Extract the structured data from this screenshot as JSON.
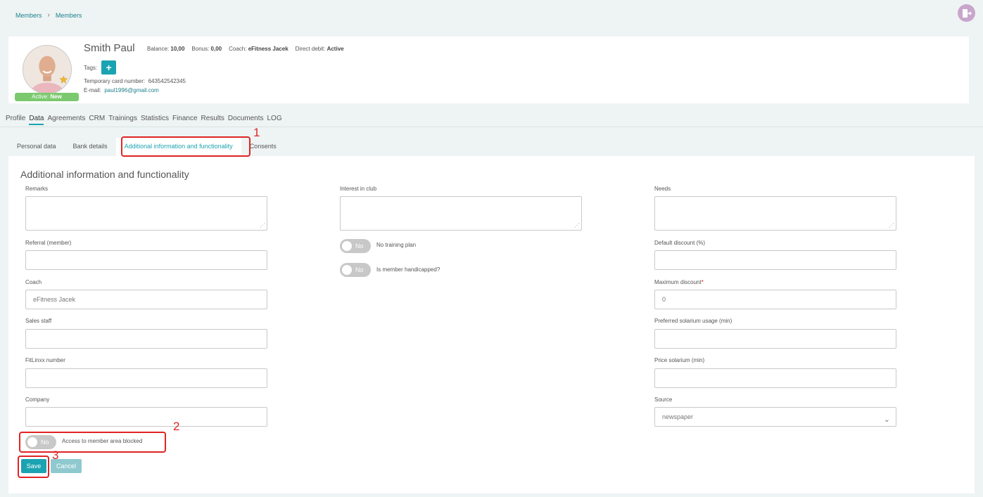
{
  "breadcrumb": {
    "items": [
      "Members",
      "Members"
    ]
  },
  "member": {
    "name": "Smith Paul",
    "status_prefix": "Active: ",
    "status_value": "New",
    "balance_label": "Balance:",
    "balance_value": "10,00",
    "bonus_label": "Bonus:",
    "bonus_value": "0,00",
    "coach_label": "Coach:",
    "coach_value": "eFitness Jacek",
    "debit_label": "Direct debit:",
    "debit_value": "Active",
    "tags_label": "Tags:",
    "tags_add": "+",
    "card_label": "Temporary card number:",
    "card_value": "643542542345",
    "email_label": "E-mail:",
    "email_value": "paul1996@gmail.com"
  },
  "main_tabs": [
    "Profile",
    "Data",
    "Agreements",
    "CRM",
    "Trainings",
    "Statistics",
    "Finance",
    "Results",
    "Documents",
    "LOG"
  ],
  "sub_tabs": [
    "Personal data",
    "Bank details",
    "Additional information and functionality",
    "Consents"
  ],
  "panel": {
    "title": "Additional information and functionality",
    "remarks_label": "Remarks",
    "interest_label": "Interest in club",
    "needs_label": "Needs",
    "referral_label": "Referral (member)",
    "coach_label": "Coach",
    "coach_value": "eFitness Jacek",
    "sales_label": "Sales staff",
    "fitlinxx_label": "FitLinxx number",
    "company_label": "Company",
    "no_training_label": "No training plan",
    "handicapped_label": "Is member handicapped?",
    "default_discount_label": "Default discount (%)",
    "max_discount_label": "Maximum discount",
    "max_discount_required": "*",
    "max_discount_value": "0",
    "solarium_usage_label": "Preferred solarium usage (min)",
    "price_solarium_label": "Price solarium (min)",
    "source_label": "Source",
    "source_value": "newspaper",
    "toggle_off": "No",
    "access_blocked_label": "Access to member area blocked",
    "save": "Save",
    "cancel": "Cancel"
  },
  "annotations": [
    "1",
    "2",
    "3"
  ],
  "colors": {
    "accent": "#1ba3b1",
    "highlight": "#e02424",
    "active_status": "#7bc96f"
  }
}
